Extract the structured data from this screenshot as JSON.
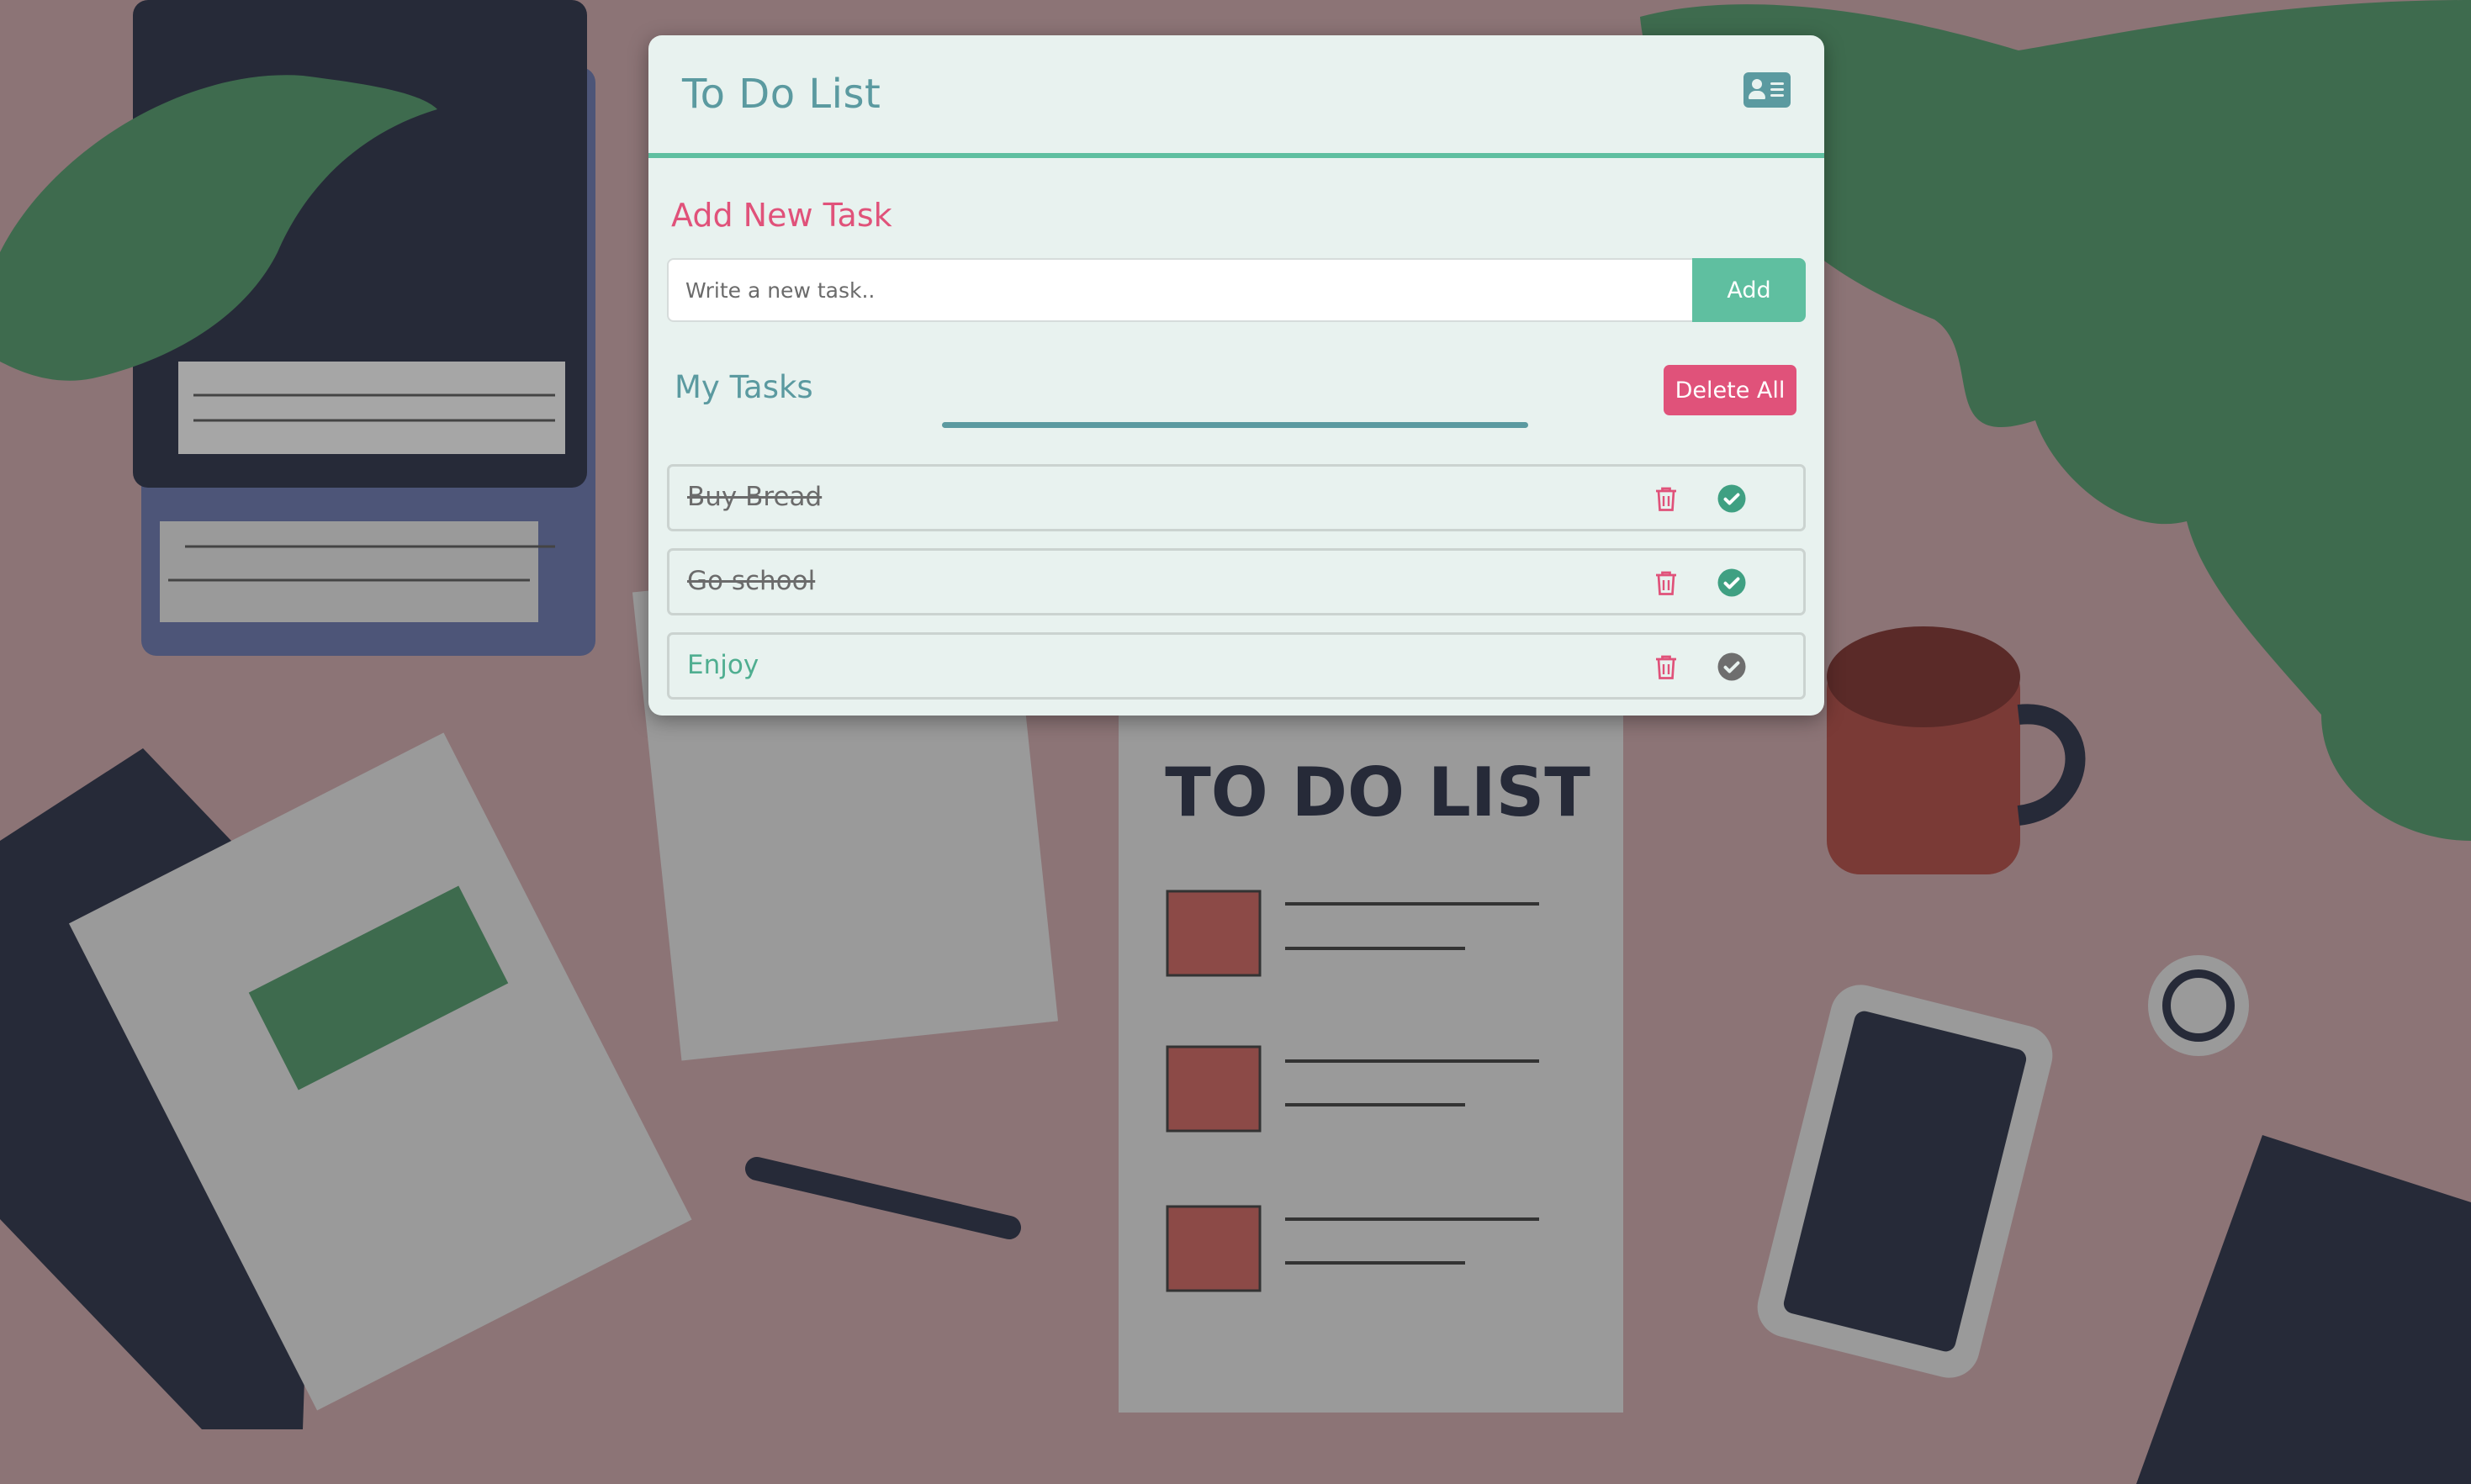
{
  "colors": {
    "accent_teal": "#5b9aa0",
    "accent_green": "#5fbfa0",
    "accent_pink": "#e0527a",
    "card_bg": "#e8f2ef",
    "check_done": "#3fa082",
    "check_pending": "#6e6e6e"
  },
  "header": {
    "title": "To Do List",
    "icon": "contact-card-icon"
  },
  "add_section": {
    "title": "Add New Task",
    "input_value": "",
    "input_placeholder": "Write a new task..",
    "add_label": "Add"
  },
  "tasks_section": {
    "title": "My Tasks",
    "delete_all_label": "Delete All",
    "items": [
      {
        "text": "Buy Bread",
        "completed": true
      },
      {
        "text": "Go school",
        "completed": true
      },
      {
        "text": "Enjoy",
        "completed": false
      }
    ]
  },
  "background": {
    "illustration_title": "TO DO LIST"
  }
}
